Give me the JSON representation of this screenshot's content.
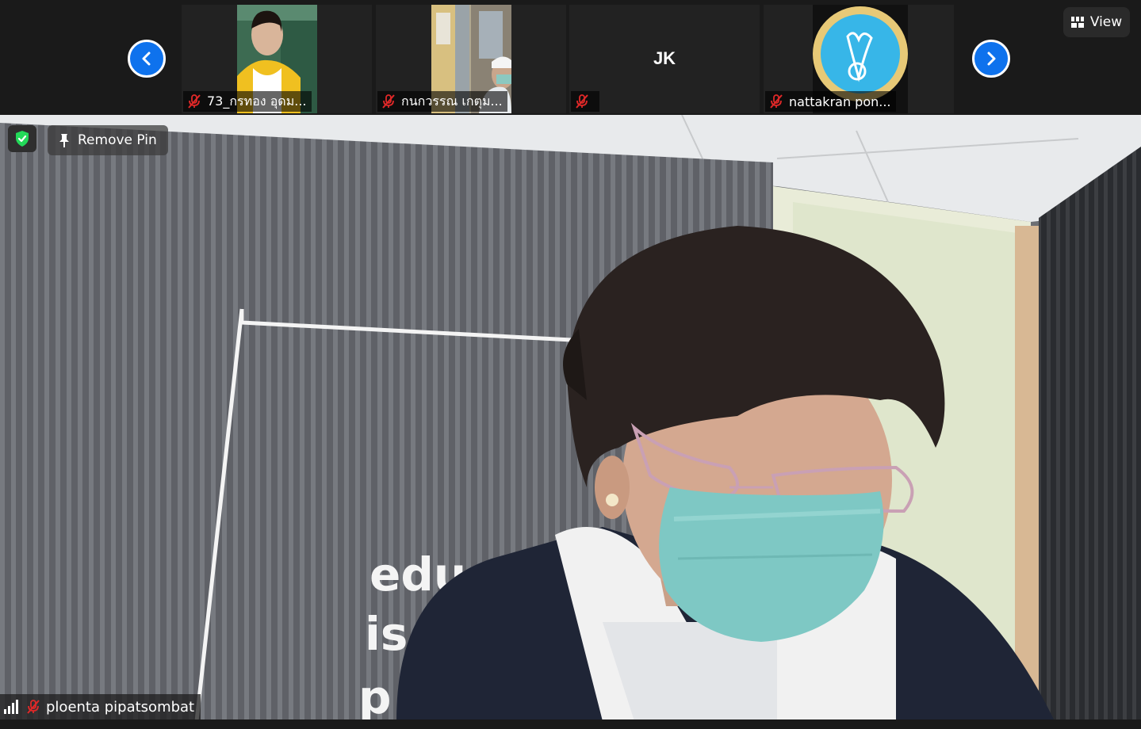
{
  "strip": {
    "participants": [
      {
        "name": "73_กรทอง อุดม...",
        "muted": true
      },
      {
        "name": "กนกวรรณ เกตุม...",
        "muted": true
      },
      {
        "name": "",
        "initials": "JK",
        "muted": true
      },
      {
        "name": "nattakran pon...",
        "muted": true
      }
    ]
  },
  "view_button": {
    "label": "View",
    "icon": "grid-icon"
  },
  "main": {
    "remove_pin_label": "Remove Pin",
    "speaker_name": "ploenta pipatsombat",
    "background_text": [
      "edu",
      "is",
      "p"
    ]
  },
  "colors": {
    "accent": "#0e72ed",
    "mic_muted": "#e02828",
    "shield": "#23d959"
  }
}
